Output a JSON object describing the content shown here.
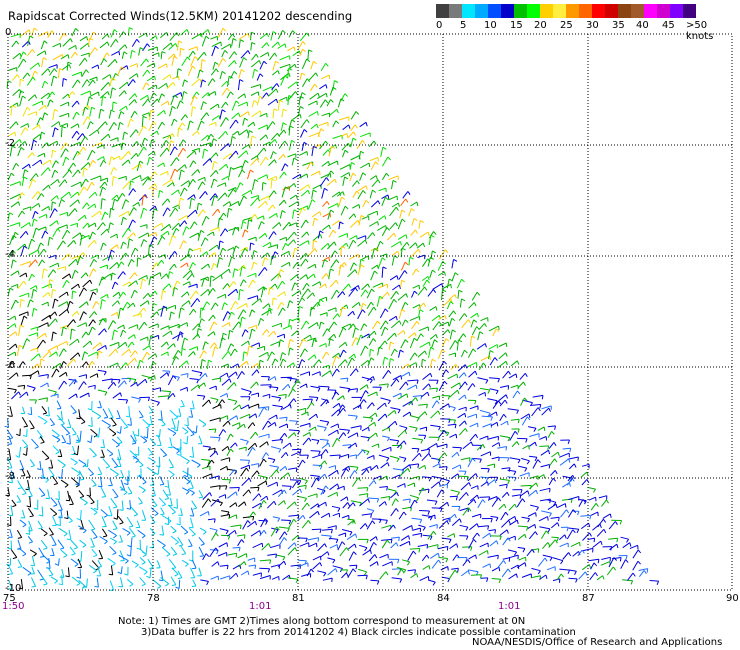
{
  "header": {
    "title": "Rapidscat Corrected Winds(12.5KM) 20141202 descending"
  },
  "legend": {
    "colors": [
      "#404040",
      "#7a7a7a",
      "#00e6ff",
      "#00aaff",
      "#0050ff",
      "#0000c8",
      "#00c000",
      "#00ff00",
      "#ffd000",
      "#ffee40",
      "#ff9900",
      "#ff6600",
      "#ff0000",
      "#d00000",
      "#8b4513",
      "#a05a2c",
      "#ff00ff",
      "#d000d0",
      "#8000ff",
      "#400080"
    ],
    "labels": [
      "0",
      "5",
      "10",
      "15",
      "20",
      "25",
      "30",
      "35",
      "40",
      "45",
      ">50 knots"
    ]
  },
  "map": {
    "lat_labels": [
      "0",
      "-2",
      "-4",
      "-6",
      "-8",
      "-10"
    ],
    "lon_labels": [
      "75",
      "78",
      "81",
      "84",
      "87",
      "90"
    ],
    "time_labels": [
      "1:50",
      "1:01",
      "1:01"
    ]
  },
  "footer": {
    "note_line1": "Note: 1) Times are GMT 2)Times along bottom correspond to measurement at 0N",
    "note_line2": "3)Data buffer is 22 hrs from 20141202 4) Black circles indicate possible contamination",
    "credit": "NOAA/NESDIS/Office of Research and Applications"
  }
}
